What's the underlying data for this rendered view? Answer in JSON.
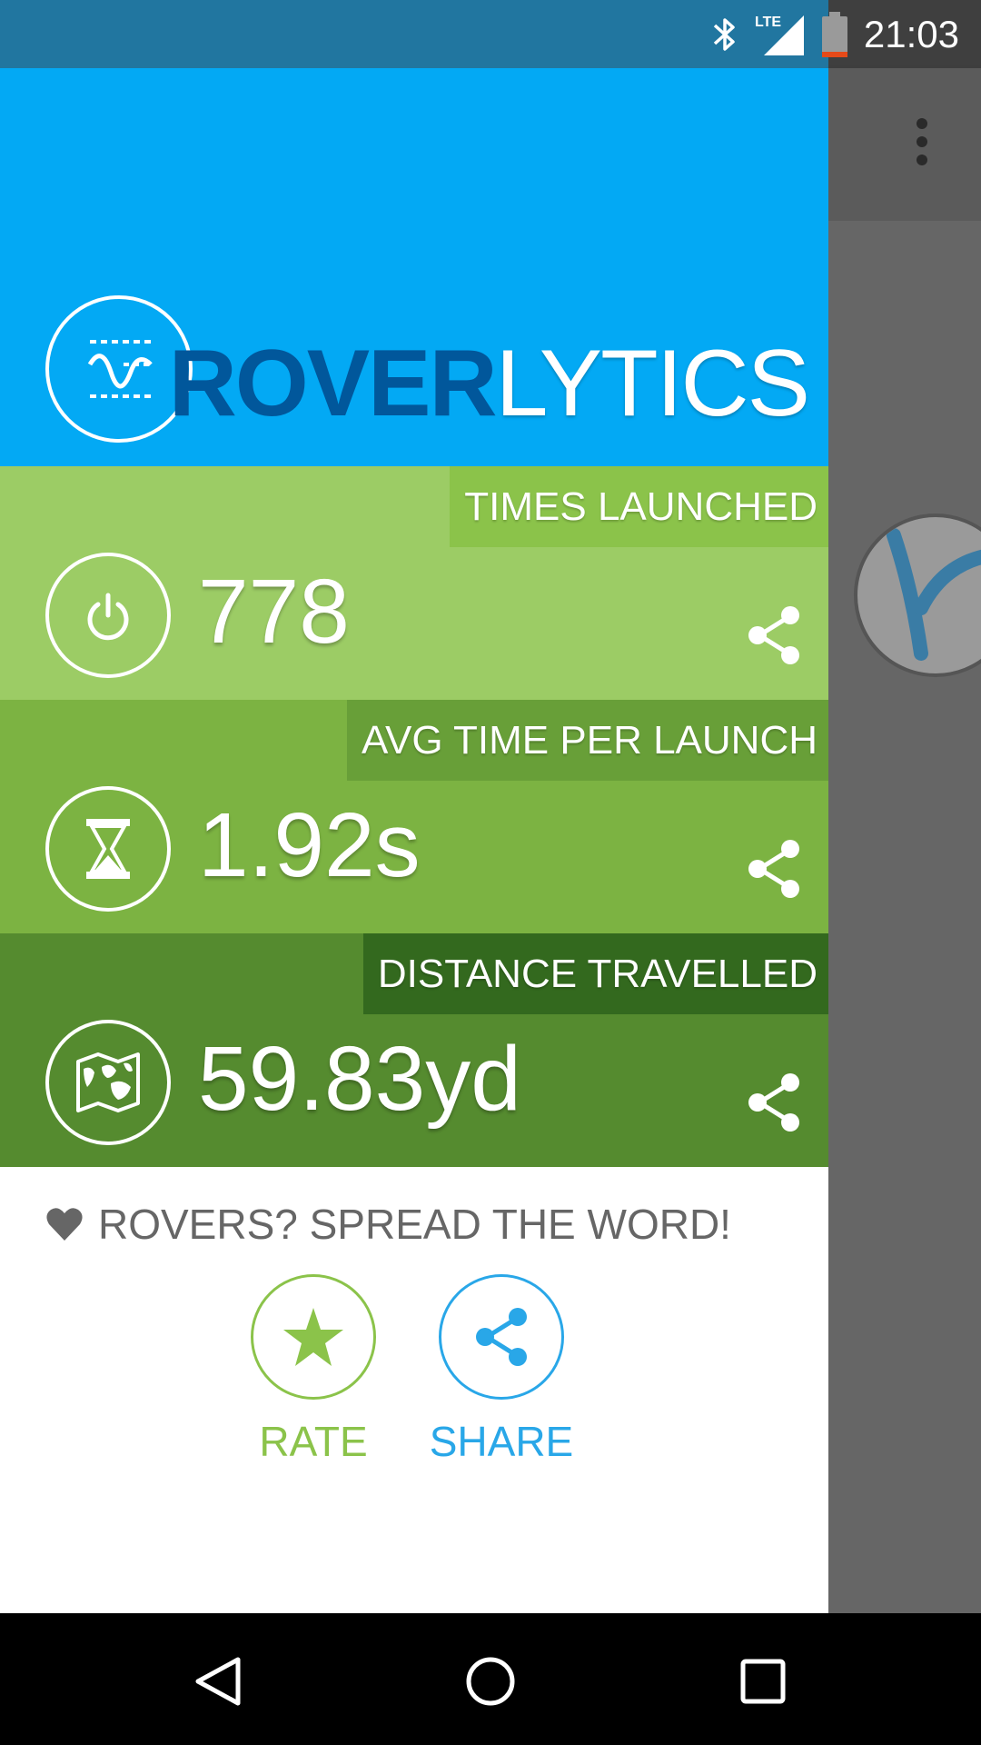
{
  "status_bar": {
    "time": "21:03",
    "icons": [
      "bluetooth-icon",
      "lte-signal-icon",
      "battery-icon"
    ],
    "network_label": "LTE"
  },
  "header": {
    "brand_part1": "ROVER",
    "brand_part2": "LYTICS",
    "logo_icon": "waveform-logo-icon"
  },
  "stats": [
    {
      "label": "TIMES LAUNCHED",
      "value": "778",
      "icon": "power-icon"
    },
    {
      "label": "AVG TIME PER LAUNCH",
      "value": "1.92s",
      "icon": "hourglass-icon"
    },
    {
      "label": "DISTANCE TRAVELLED",
      "value": "59.83yd",
      "icon": "map-icon"
    }
  ],
  "spread": {
    "title": "ROVERS? SPREAD THE WORD!",
    "rate_label": "RATE",
    "share_label": "SHARE"
  },
  "colors": {
    "header": "#03a9f4",
    "brand_dark": "#01579b",
    "rate": "#8bc34a",
    "share": "#29a7e8"
  },
  "nav": [
    "back-icon",
    "home-icon",
    "recents-icon"
  ]
}
